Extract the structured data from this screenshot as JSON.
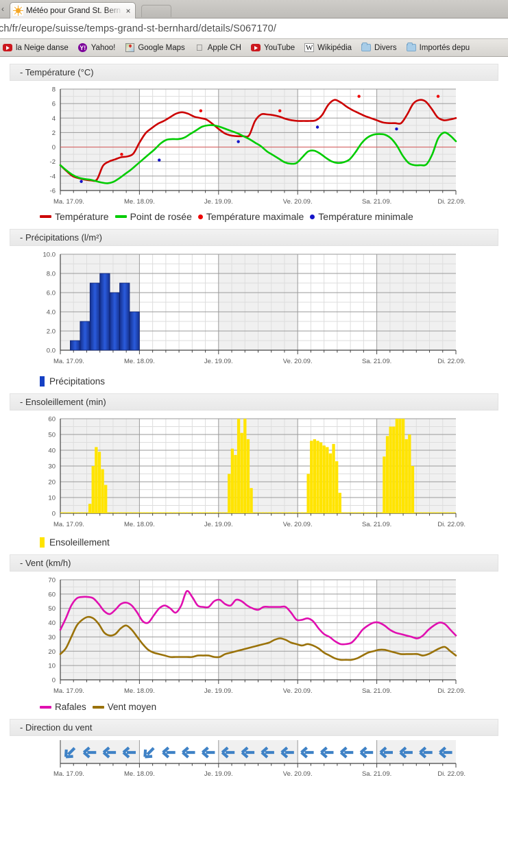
{
  "browser": {
    "back_arrow": "‹",
    "tab": {
      "favicon_name": "sun-icon",
      "title": "Météo pour Grand St. Bern",
      "close_label": "×"
    },
    "new_tab_label": "",
    "url": "ch/fr/europe/suisse/temps-grand-st-bernhard/details/S067170/",
    "bookmarks": [
      {
        "label": "la Neige danse",
        "icon": "youtube-icon"
      },
      {
        "label": "Yahoo!",
        "icon": "yahoo-icon",
        "glyph": "Y!"
      },
      {
        "label": "Google Maps",
        "icon": "google-maps-icon"
      },
      {
        "label": "Apple CH",
        "icon": "apple-icon",
        "glyph": ""
      },
      {
        "label": "YouTube",
        "icon": "youtube-icon"
      },
      {
        "label": "Wikipédia",
        "icon": "wikipedia-icon",
        "glyph": "W"
      },
      {
        "label": "Divers",
        "icon": "folder-icon"
      },
      {
        "label": "Importés depu",
        "icon": "folder-icon"
      }
    ]
  },
  "sections": {
    "temperature": {
      "header": "- Température (°C)"
    },
    "precipitation": {
      "header": "- Précipitations (l/m²)"
    },
    "sunshine": {
      "header": "- Ensoleillement (min)"
    },
    "wind": {
      "header": "- Vent (km/h)"
    },
    "winddir": {
      "header": "- Direction du vent"
    }
  },
  "days": [
    "Ma. 17.09.",
    "Me. 18.09.",
    "Je. 19.09.",
    "Ve. 20.09.",
    "Sa. 21.09.",
    "Di. 22.09."
  ],
  "colors": {
    "temperature": "#cc0000",
    "dewpoint": "#00cc00",
    "tmax": "#ee0000",
    "tmin": "#1414c8",
    "precip": "#1540c4",
    "sun": "#ffe400",
    "gusts": "#e00fb0",
    "meanwind": "#9a7209",
    "arrow": "#3f82c6",
    "zeroline": "#e06060",
    "grid_major": "#9a9a9a",
    "grid_minor": "#dddddd",
    "plot_bg_a": "#f0f0f0",
    "plot_bg_b": "#ffffff"
  },
  "chart_data": [
    {
      "id": "temperature",
      "type": "line",
      "title": "- Température (°C)",
      "ylabel": "°C",
      "ylim": [
        -6,
        8
      ],
      "yticks": [
        8,
        6,
        4,
        2,
        0,
        -2,
        -4,
        -6
      ],
      "xlabel": "",
      "xticklabels": [
        "Ma. 17.09.",
        "Me. 18.09.",
        "Je. 19.09.",
        "Ve. 20.09.",
        "Sa. 21.09.",
        "Di. 22.09."
      ],
      "grid": true,
      "legend_position": "below",
      "zero_line": 0,
      "series": [
        {
          "name": "Température",
          "color": "#cc0000",
          "values": [
            -2.5,
            -3.3,
            -4.0,
            -4.3,
            -4.5,
            -4.6,
            -4.5,
            -2.6,
            -2.0,
            -1.7,
            -1.4,
            -1.3,
            -0.9,
            0.6,
            1.9,
            2.6,
            3.2,
            3.6,
            4.1,
            4.6,
            4.8,
            4.6,
            4.2,
            4.0,
            3.8,
            3.2,
            2.5,
            1.9,
            1.6,
            1.5,
            1.5,
            1.6,
            3.6,
            4.5,
            4.5,
            4.4,
            4.2,
            3.9,
            3.7,
            3.6,
            3.6,
            3.6,
            3.7,
            4.4,
            5.8,
            6.5,
            6.2,
            5.6,
            5.1,
            4.7,
            4.3,
            4.0,
            3.7,
            3.4,
            3.3,
            3.3,
            3.3,
            4.5,
            6.0,
            6.5,
            6.3,
            5.3,
            4.1,
            3.7,
            3.8,
            4.0
          ]
        },
        {
          "name": "Point de rosée",
          "color": "#00cc00",
          "values": [
            -2.5,
            -3.2,
            -3.8,
            -4.2,
            -4.4,
            -4.5,
            -4.7,
            -4.9,
            -5.0,
            -4.8,
            -4.3,
            -3.7,
            -3.1,
            -2.4,
            -1.7,
            -1.0,
            -0.3,
            0.5,
            1.0,
            1.1,
            1.1,
            1.3,
            1.8,
            2.3,
            2.8,
            3.0,
            3.0,
            2.8,
            2.5,
            2.2,
            1.9,
            1.5,
            1.1,
            0.6,
            0.1,
            -0.6,
            -1.1,
            -1.6,
            -2.1,
            -2.3,
            -2.2,
            -1.4,
            -0.6,
            -0.5,
            -0.9,
            -1.5,
            -2.0,
            -2.2,
            -2.1,
            -1.7,
            -0.7,
            0.5,
            1.3,
            1.7,
            1.8,
            1.7,
            1.2,
            0.2,
            -1.2,
            -2.2,
            -2.5,
            -2.5,
            -2.4,
            -1.0,
            1.2,
            2.0,
            1.6,
            0.8
          ]
        }
      ],
      "points": [
        {
          "name": "Température maximale",
          "color": "#ee0000",
          "data": [
            [
              0.155,
              -1.0
            ],
            [
              0.355,
              5.0
            ],
            [
              0.555,
              5.0
            ],
            [
              0.755,
              7.0
            ],
            [
              0.955,
              7.0
            ]
          ]
        },
        {
          "name": "Température minimale",
          "color": "#1414c8",
          "data": [
            [
              0.053,
              -4.75
            ],
            [
              0.25,
              -1.8
            ],
            [
              0.45,
              0.75
            ],
            [
              0.65,
              2.75
            ],
            [
              0.85,
              2.5
            ]
          ]
        }
      ],
      "legend": [
        {
          "label": "Température",
          "color": "#cc0000",
          "marker": "line"
        },
        {
          "label": "Point de rosée",
          "color": "#00cc00",
          "marker": "line"
        },
        {
          "label": "Température maximale",
          "color": "#ee0000",
          "marker": "dot"
        },
        {
          "label": "Température minimale",
          "color": "#1414c8",
          "marker": "dot"
        }
      ]
    },
    {
      "id": "precipitation",
      "type": "bar",
      "title": "- Précipitations (l/m²)",
      "ylabel": "l/m²",
      "ylim": [
        0,
        10
      ],
      "yticks": [
        "10.0",
        "8.0",
        "6.0",
        "4.0",
        "2.0",
        "0.0"
      ],
      "ytickvalues": [
        10,
        8,
        6,
        4,
        2,
        0
      ],
      "xticklabels": [
        "Ma. 17.09.",
        "Me. 18.09.",
        "Je. 19.09.",
        "Ve. 20.09.",
        "Sa. 21.09.",
        "Di. 22.09."
      ],
      "grid": true,
      "bar_color": "#1540c4",
      "bar_interval_hours": 3,
      "bar_start_fraction": 0.125,
      "values": [
        1,
        3,
        7,
        8,
        6,
        7,
        4
      ],
      "legend": [
        {
          "label": "Précipitations",
          "color": "#1540c4",
          "marker": "bar"
        }
      ]
    },
    {
      "id": "sunshine",
      "type": "bar",
      "title": "- Ensoleillement (min)",
      "ylabel": "min",
      "ylim": [
        0,
        60
      ],
      "yticks": [
        60,
        50,
        40,
        30,
        20,
        10,
        0
      ],
      "xticklabels": [
        "Ma. 17.09.",
        "Me. 18.09.",
        "Je. 19.09.",
        "Ve. 20.09.",
        "Sa. 21.09.",
        "Di. 22.09."
      ],
      "grid": true,
      "bar_color": "#ffe400",
      "bars": [
        [
          0.071,
          6
        ],
        [
          0.079,
          30
        ],
        [
          0.087,
          42
        ],
        [
          0.095,
          39
        ],
        [
          0.103,
          28
        ],
        [
          0.111,
          18
        ],
        [
          0.423,
          25
        ],
        [
          0.431,
          41
        ],
        [
          0.439,
          37
        ],
        [
          0.447,
          60
        ],
        [
          0.455,
          51
        ],
        [
          0.463,
          60
        ],
        [
          0.471,
          47
        ],
        [
          0.479,
          16
        ],
        [
          0.623,
          25
        ],
        [
          0.631,
          46
        ],
        [
          0.639,
          47
        ],
        [
          0.647,
          46
        ],
        [
          0.655,
          45
        ],
        [
          0.663,
          43
        ],
        [
          0.671,
          42
        ],
        [
          0.679,
          38
        ],
        [
          0.687,
          44
        ],
        [
          0.695,
          33
        ],
        [
          0.703,
          13
        ],
        [
          0.815,
          36
        ],
        [
          0.823,
          49
        ],
        [
          0.831,
          55
        ],
        [
          0.839,
          55
        ],
        [
          0.847,
          60
        ],
        [
          0.855,
          60
        ],
        [
          0.863,
          60
        ],
        [
          0.871,
          47
        ],
        [
          0.879,
          50
        ],
        [
          0.887,
          30
        ]
      ],
      "legend": [
        {
          "label": "Ensoleillement",
          "color": "#ffe400",
          "marker": "bar"
        }
      ]
    },
    {
      "id": "wind",
      "type": "line",
      "title": "- Vent (km/h)",
      "ylabel": "km/h",
      "ylim": [
        0,
        70
      ],
      "yticks": [
        70,
        60,
        50,
        40,
        30,
        20,
        10,
        0
      ],
      "xticklabels": [
        "Ma. 17.09.",
        "Me. 18.09.",
        "Je. 19.09.",
        "Ve. 20.09.",
        "Sa. 21.09.",
        "Di. 22.09."
      ],
      "grid": true,
      "series": [
        {
          "name": "Rafales",
          "color": "#e00fb0",
          "values": [
            35,
            43,
            52,
            57,
            58,
            58,
            57,
            53,
            48,
            46,
            49,
            53,
            54,
            52,
            47,
            41,
            40,
            45,
            50,
            52,
            50,
            47,
            52,
            62,
            58,
            52,
            51,
            51,
            55,
            56,
            53,
            52,
            56,
            55,
            52,
            50,
            49,
            51,
            51,
            51,
            51,
            51,
            47,
            42,
            42,
            43,
            41,
            36,
            32,
            30,
            27,
            25,
            25,
            26,
            30,
            35,
            38,
            40,
            40,
            38,
            35,
            33,
            32,
            31,
            30,
            29,
            31,
            35,
            38,
            40,
            39,
            35,
            31
          ]
        },
        {
          "name": "Vent moyen",
          "color": "#9a7209",
          "values": [
            18,
            22,
            30,
            38,
            42,
            44,
            43,
            39,
            33,
            31,
            32,
            36,
            38,
            35,
            30,
            25,
            21,
            19,
            18,
            17,
            16,
            16,
            16,
            16,
            16,
            17,
            17,
            17,
            16,
            16,
            18,
            19,
            20,
            21,
            22,
            23,
            24,
            25,
            26,
            28,
            29,
            28,
            26,
            25,
            24,
            25,
            24,
            22,
            19,
            17,
            15,
            14,
            14,
            14,
            15,
            17,
            19,
            20,
            21,
            21,
            20,
            19,
            18,
            18,
            18,
            18,
            17,
            18,
            20,
            22,
            23,
            20,
            17
          ]
        }
      ],
      "legend": [
        {
          "label": "Rafales",
          "color": "#e00fb0",
          "marker": "line"
        },
        {
          "label": "Vent moyen",
          "color": "#9a7209",
          "marker": "line"
        }
      ]
    },
    {
      "id": "winddir",
      "type": "arrows",
      "title": "- Direction du vent",
      "xticklabels": [
        "Ma. 17.09.",
        "Me. 18.09.",
        "Je. 19.09.",
        "Ve. 20.09.",
        "Sa. 21.09.",
        "Di. 22.09."
      ],
      "arrow_color": "#3f82c6",
      "arrow_rotations_deg": [
        -45,
        0,
        0,
        0,
        -45,
        0,
        0,
        0,
        0,
        0,
        0,
        0,
        0,
        0,
        0,
        0,
        0,
        0,
        0,
        0
      ],
      "arrow_count": 20
    }
  ]
}
